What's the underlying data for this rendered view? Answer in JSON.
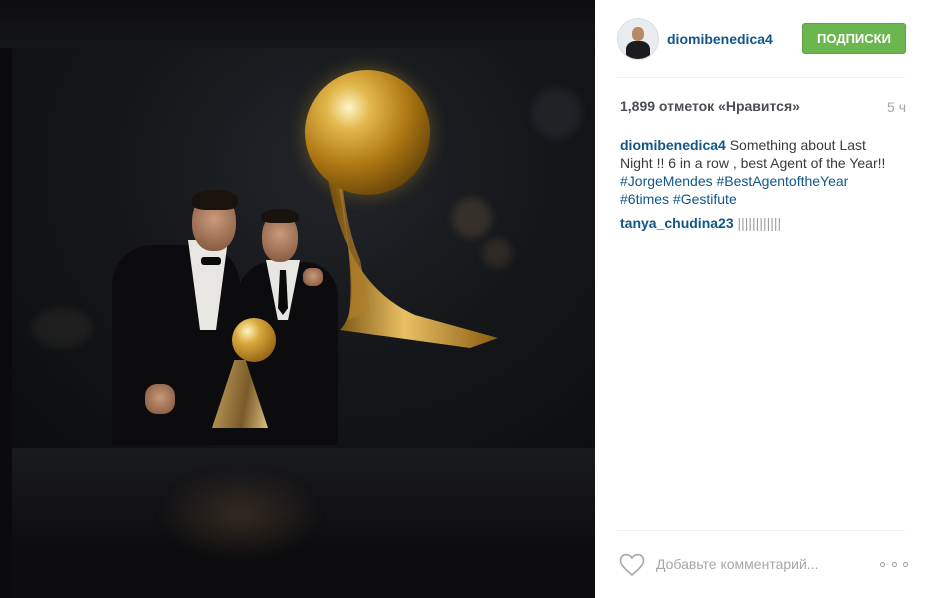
{
  "header": {
    "username": "diomibenedica4",
    "follow_label": "ПОДПИСКИ"
  },
  "stats": {
    "likes_text": "1,899 отметок «Нравится»",
    "time_ago": "5 ч"
  },
  "caption": {
    "username": "diomibenedica4",
    "text": " Something about Last Night !! 6 in a row , best Agent of the Year!! ",
    "hashtags": [
      "#JorgeMendes",
      "#BestAgentoftheYear",
      "#6times",
      "#Gestifute"
    ]
  },
  "comments": [
    {
      "username": "tanya_chudina23",
      "text": "||||||||||||"
    }
  ],
  "footer": {
    "comment_placeholder": "Добавьте комментарий..."
  },
  "colors": {
    "link": "#125688",
    "follow_button": "#6bb64f",
    "muted": "#a5a7aa"
  },
  "icons": {
    "like": "heart-outline-icon",
    "more": "ellipsis-icon"
  }
}
